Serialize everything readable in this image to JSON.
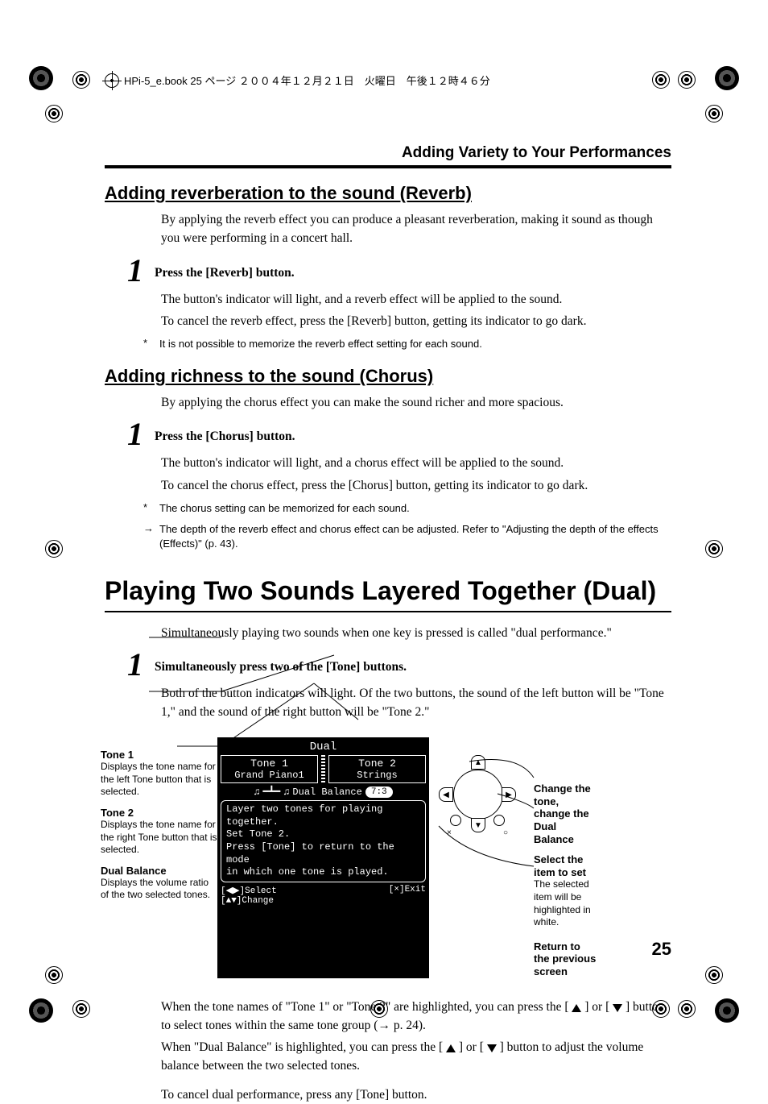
{
  "header": {
    "book_info": "HPi-5_e.book 25 ページ ２００４年１２月２１日　火曜日　午後１２時４６分",
    "section_title": "Adding Variety to Your Performances"
  },
  "reverb": {
    "heading": "Adding reverberation to the sound (Reverb)",
    "intro": "By applying the reverb effect you can produce a pleasant reverberation, making it sound as though you were performing in a concert hall.",
    "step_num": "1",
    "step_title": "Press the [Reverb] button.",
    "step_body1": "The button's indicator will light, and a reverb effect will be applied to the sound.",
    "step_body2": "To cancel the reverb effect, press the [Reverb] button, getting its indicator to go dark.",
    "note_marker": "*",
    "note": "It is not possible to memorize the reverb effect setting for each sound."
  },
  "chorus": {
    "heading": "Adding richness to the sound (Chorus)",
    "intro": "By applying the chorus effect you can make the sound richer and more spacious.",
    "step_num": "1",
    "step_title": "Press the [Chorus] button.",
    "step_body1": "The button's indicator will light, and a chorus effect will be applied to the sound.",
    "step_body2": "To cancel the chorus effect, press the [Chorus] button, getting its indicator to go dark.",
    "note1_marker": "*",
    "note1": "The chorus setting can be memorized for each sound.",
    "note2_marker": "→",
    "note2": "The depth of the reverb effect and chorus effect can be adjusted. Refer to \"Adjusting the depth of the effects (Effects)\" (p. 43)."
  },
  "dual": {
    "heading": "Playing Two Sounds Layered Together (Dual)",
    "intro": "Simultaneously playing two sounds when one key is pressed is called \"dual performance.\"",
    "step_num": "1",
    "step_title": "Simultaneously press two of the [Tone] buttons.",
    "step_body": "Both of the button indicators will light. Of the two buttons, the sound of the left button will be \"Tone 1,\" and the sound of the right button will be \"Tone 2.\"",
    "left_labels": {
      "tone1_title": "Tone 1",
      "tone1_desc": "Displays the tone name for the left Tone button that is selected.",
      "tone2_title": "Tone 2",
      "tone2_desc": "Displays the tone name for the right Tone button that is selected.",
      "dualbal_title": "Dual Balance",
      "dualbal_desc": "Displays the volume ratio of the two selected tones."
    },
    "lcd": {
      "title": "Dual",
      "tone1_label": "Tone 1",
      "tone1_value": "Grand Piano1",
      "tone2_label": "Tone 2",
      "tone2_value": "Strings",
      "balance_label": "Dual Balance",
      "balance_value": "7:3",
      "msg_l1": "Layer two tones for playing together.",
      "msg_l2": "Set Tone 2.",
      "msg_l3": "Press [Tone] to return to the mode",
      "msg_l4": "in which one tone is played.",
      "foot_select": "[◀▶]Select",
      "foot_change": "[▲▼]Change",
      "foot_exit": "[×]Exit"
    },
    "right_labels": {
      "change_title": "Change the tone, change the Dual Balance",
      "select_title": "Select the item to set",
      "select_desc": "The selected item will be highlighted in white.",
      "return_title": "Return to the previous screen"
    },
    "after1a": "When the tone names of \"Tone 1\" or \"Tone 2\" are highlighted, you can press the [ ",
    "after1b": " ] or [ ",
    "after1c": " ] button to select tones within the same tone group (→ p. 24).",
    "after2a": "When \"Dual Balance\" is highlighted, you can press the [ ",
    "after2b": " ] or [ ",
    "after2c": " ] button to adjust the volume balance between the two selected tones.",
    "after3": "To cancel dual performance, press any [Tone] button."
  },
  "page_number": "25"
}
